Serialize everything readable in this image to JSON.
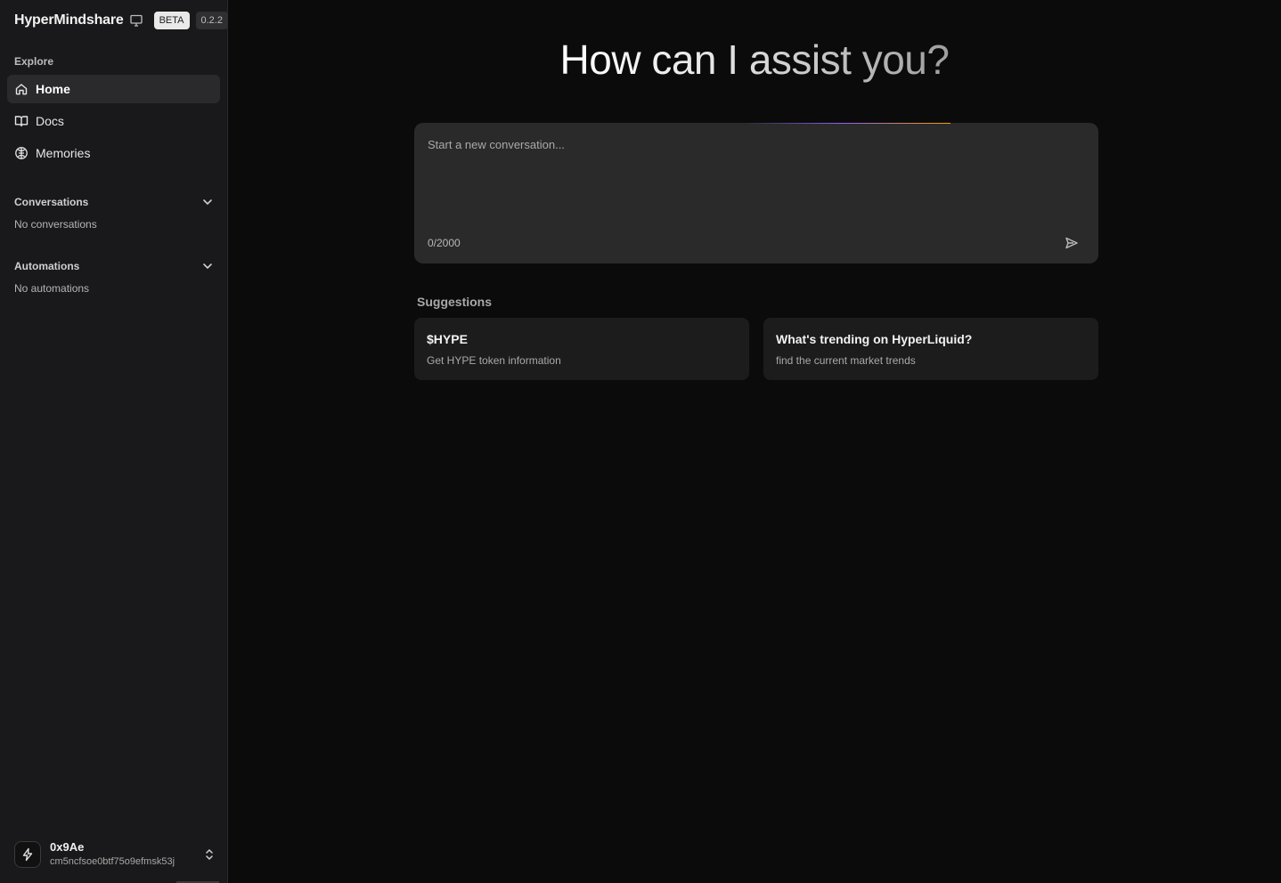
{
  "sidebar": {
    "brand": "HyperMindshare",
    "badge_beta": "BETA",
    "version": "0.2.2",
    "explore_label": "Explore",
    "nav": [
      {
        "label": "Home",
        "icon": "home-icon",
        "active": true
      },
      {
        "label": "Docs",
        "icon": "book-icon",
        "active": false
      },
      {
        "label": "Memories",
        "icon": "brain-icon",
        "active": false
      }
    ],
    "conversations": {
      "title": "Conversations",
      "empty": "No conversations"
    },
    "automations": {
      "title": "Automations",
      "empty": "No automations"
    },
    "account": {
      "name": "0x9Ae",
      "id": "cm5ncfsoe0btf75o9efmsk53j"
    }
  },
  "main": {
    "hero": "How can I assist you?",
    "composer": {
      "placeholder": "Start a new conversation...",
      "counter": "0/2000"
    },
    "suggestions_label": "Suggestions",
    "suggestions": [
      {
        "title": "$HYPE",
        "subtitle": "Get HYPE token information"
      },
      {
        "title": "What's trending on HyperLiquid?",
        "subtitle": "find the current market trends"
      }
    ]
  },
  "colors": {
    "background": "#0b0b0b",
    "sidebar": "#19191b",
    "composer": "#2a2a2a",
    "card": "#1c1c1c",
    "accent_purple": "#8b5cf6",
    "accent_orange": "#f59e0b"
  }
}
